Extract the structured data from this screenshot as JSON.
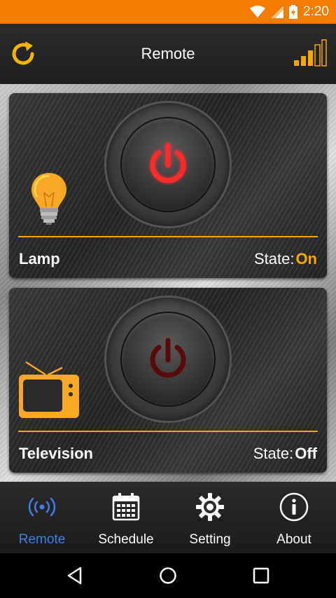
{
  "status_bar": {
    "time": "2:20"
  },
  "app_bar": {
    "title": "Remote"
  },
  "devices": [
    {
      "name": "Lamp",
      "state_label": "State:",
      "state_value": "On"
    },
    {
      "name": "Television",
      "state_label": "State:",
      "state_value": "Off"
    }
  ],
  "nav": {
    "items": [
      {
        "label": "Remote",
        "icon": "remote-signal-icon",
        "active": true
      },
      {
        "label": "Schedule",
        "icon": "calendar-icon",
        "active": false
      },
      {
        "label": "Setting",
        "icon": "gear-icon",
        "active": false
      },
      {
        "label": "About",
        "icon": "info-icon",
        "active": false
      }
    ]
  },
  "colors": {
    "status_bar": "#f57c00",
    "accent": "#f7a800",
    "power_on": "#ff2a2a",
    "power_off": "#5a0a0a",
    "nav_active": "#3f7fe8"
  }
}
